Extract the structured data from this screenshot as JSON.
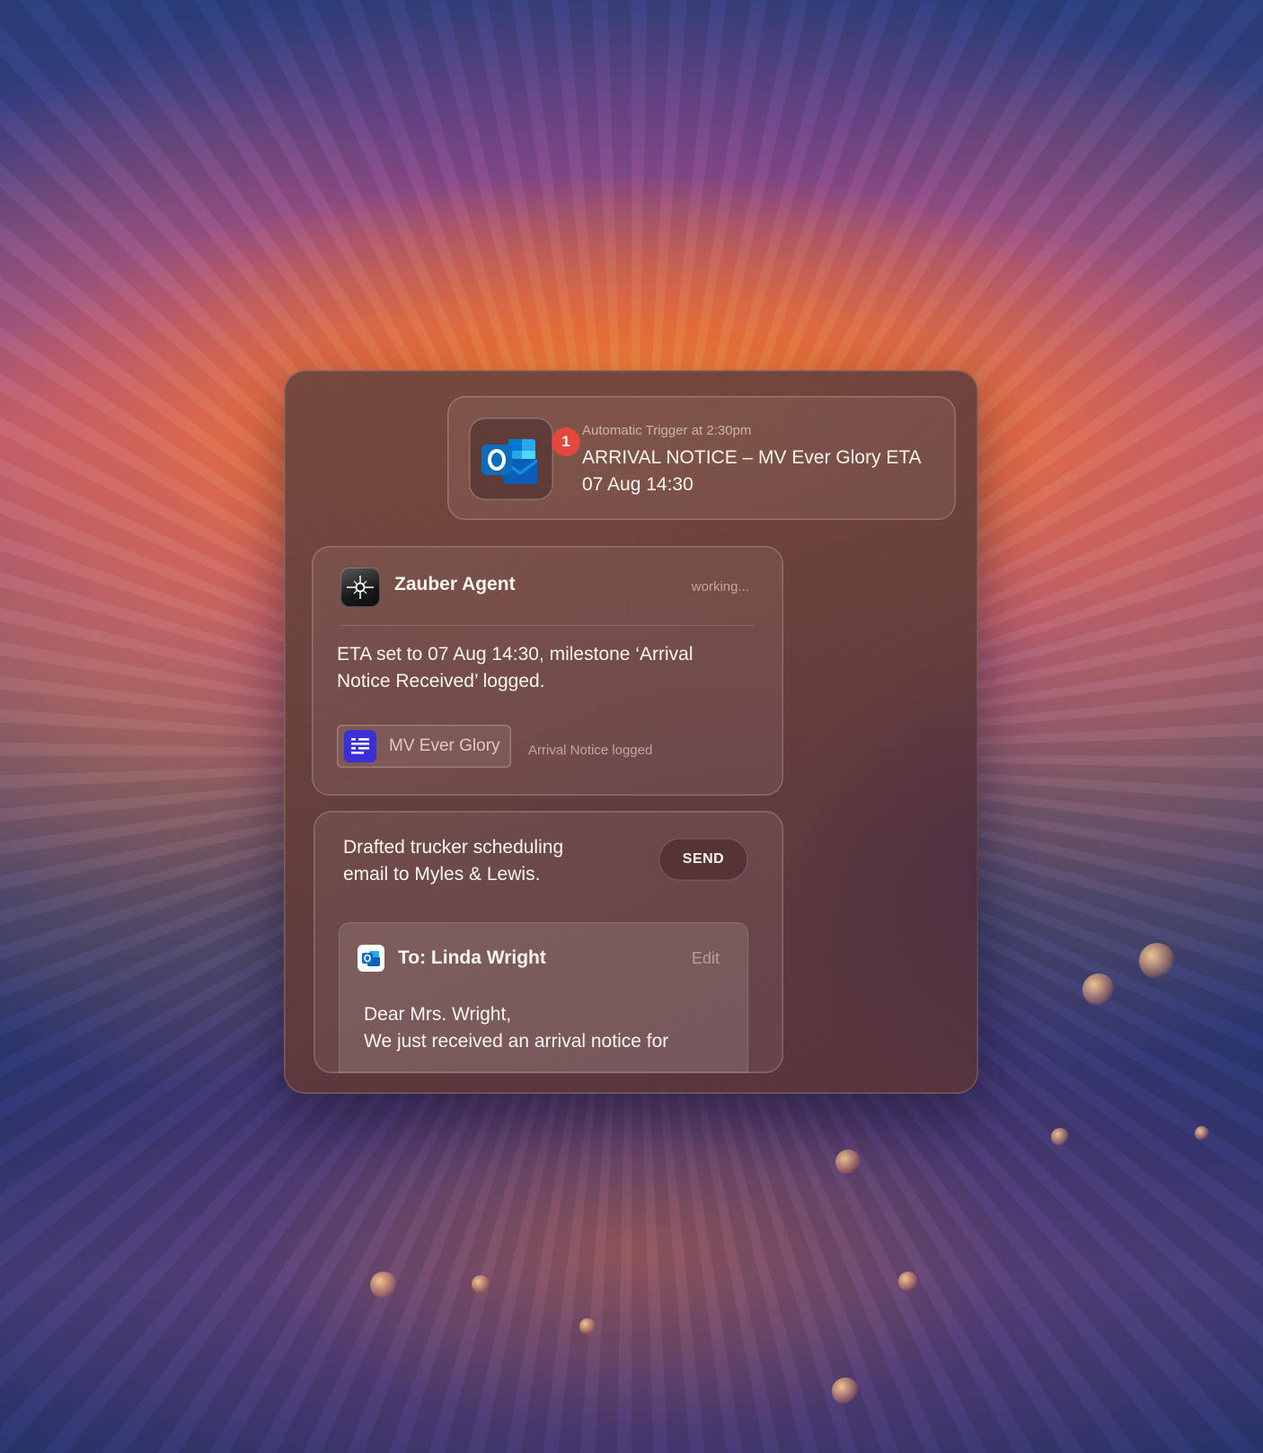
{
  "notification": {
    "badge_count": "1",
    "app_icon": "outlook-icon",
    "meta": "Automatic Trigger at 2:30pm",
    "title": "ARRIVAL NOTICE – MV Ever Glory ETA 07 Aug 14:30"
  },
  "agent": {
    "icon": "sparkle-icon",
    "name": "Zauber Agent",
    "status": "working...",
    "message": "ETA set to 07 Aug 14:30, milestone ‘Arrival Notice Received’ logged.",
    "chip_label": "MV Ever Glory",
    "chip_icon": "shipment-list-icon",
    "chip_note": "Arrival Notice logged"
  },
  "draft": {
    "message": "Drafted trucker scheduling email to Myles & Lewis.",
    "send_label": "SEND",
    "email": {
      "icon": "outlook-icon",
      "to": "To: Linda Wright",
      "edit_label": "Edit",
      "greeting": "Dear Mrs. Wright,",
      "body": "We just received an arrival notice for"
    }
  },
  "colors": {
    "badge": "#e4473d",
    "outlook_blue": "#0f6cbd",
    "chip_icon_bg": "#3b2fd6"
  }
}
